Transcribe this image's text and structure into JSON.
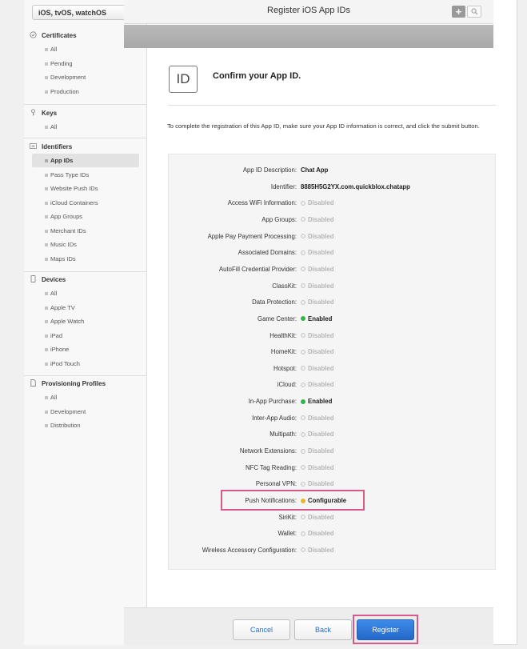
{
  "sidebar": {
    "platform_select": "iOS, tvOS, watchOS",
    "sections": [
      {
        "title": "Certificates",
        "icon": "certificate-icon",
        "items": [
          "All",
          "Pending",
          "Development",
          "Production"
        ]
      },
      {
        "title": "Keys",
        "icon": "key-icon",
        "items": [
          "All"
        ]
      },
      {
        "title": "Identifiers",
        "icon": "id-icon",
        "items": [
          "App IDs",
          "Pass Type IDs",
          "Website Push IDs",
          "iCloud Containers",
          "App Groups",
          "Merchant IDs",
          "Music IDs",
          "Maps IDs"
        ],
        "active_item": "App IDs"
      },
      {
        "title": "Devices",
        "icon": "device-icon",
        "items": [
          "All",
          "Apple TV",
          "Apple Watch",
          "iPad",
          "iPhone",
          "iPod Touch"
        ]
      },
      {
        "title": "Provisioning Profiles",
        "icon": "document-icon",
        "items": [
          "All",
          "Development",
          "Distribution"
        ]
      }
    ]
  },
  "header": {
    "title": "Register iOS App IDs",
    "add_label": "+",
    "search_icon": "search-icon"
  },
  "main": {
    "badge": "ID",
    "confirm_title": "Confirm your App ID.",
    "intro": "To complete the registration of this App ID, make sure your App ID information is correct, and click the submit button.",
    "details": [
      {
        "label": "App ID Description:",
        "value": "Chat App",
        "kind": "text"
      },
      {
        "label": "Identifier:",
        "value": "8885H5G2YX.com.quickblox.chatapp",
        "kind": "text"
      },
      {
        "label": "Access WiFi Information:",
        "value": "Disabled",
        "kind": "disabled"
      },
      {
        "label": "App Groups:",
        "value": "Disabled",
        "kind": "disabled"
      },
      {
        "label": "Apple Pay Payment Processing:",
        "value": "Disabled",
        "kind": "disabled"
      },
      {
        "label": "Associated Domains:",
        "value": "Disabled",
        "kind": "disabled"
      },
      {
        "label": "AutoFill Credential Provider:",
        "value": "Disabled",
        "kind": "disabled"
      },
      {
        "label": "ClassKit:",
        "value": "Disabled",
        "kind": "disabled"
      },
      {
        "label": "Data Protection:",
        "value": "Disabled",
        "kind": "disabled"
      },
      {
        "label": "Game Center:",
        "value": "Enabled",
        "kind": "enabled"
      },
      {
        "label": "HealthKit:",
        "value": "Disabled",
        "kind": "disabled"
      },
      {
        "label": "HomeKit:",
        "value": "Disabled",
        "kind": "disabled"
      },
      {
        "label": "Hotspot:",
        "value": "Disabled",
        "kind": "disabled"
      },
      {
        "label": "iCloud:",
        "value": "Disabled",
        "kind": "disabled"
      },
      {
        "label": "In-App Purchase:",
        "value": "Enabled",
        "kind": "enabled"
      },
      {
        "label": "Inter-App Audio:",
        "value": "Disabled",
        "kind": "disabled"
      },
      {
        "label": "Multipath:",
        "value": "Disabled",
        "kind": "disabled"
      },
      {
        "label": "Network Extensions:",
        "value": "Disabled",
        "kind": "disabled"
      },
      {
        "label": "NFC Tag Reading:",
        "value": "Disabled",
        "kind": "disabled"
      },
      {
        "label": "Personal VPN:",
        "value": "Disabled",
        "kind": "disabled"
      },
      {
        "label": "Push Notifications:",
        "value": "Configurable",
        "kind": "config"
      },
      {
        "label": "SiriKit:",
        "value": "Disabled",
        "kind": "disabled"
      },
      {
        "label": "Wallet:",
        "value": "Disabled",
        "kind": "disabled"
      },
      {
        "label": "Wireless Accessory Configuration:",
        "value": "Disabled",
        "kind": "disabled"
      }
    ]
  },
  "footer": {
    "cancel": "Cancel",
    "back": "Back",
    "register": "Register"
  },
  "colors": {
    "enabled": "#34b44a",
    "configurable": "#e6b62e",
    "highlight": "#d65b8a",
    "primary_button": "#2a6ec8"
  }
}
